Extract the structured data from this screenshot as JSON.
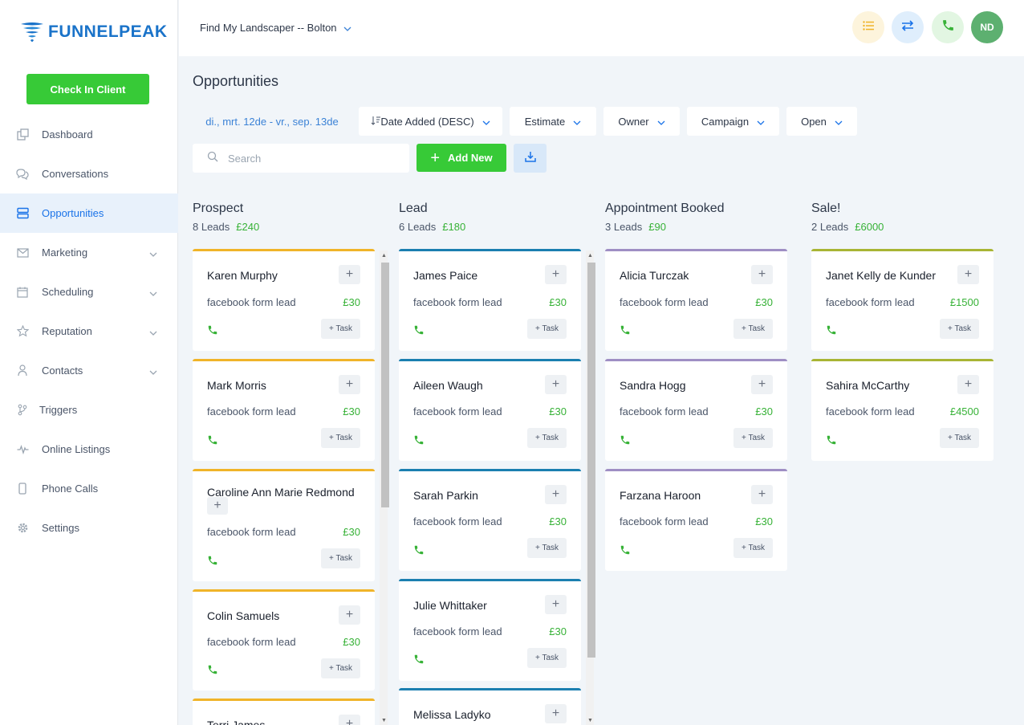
{
  "brand": {
    "logo_text_a": "FUNNELPE",
    "logo_text_b": "A",
    "logo_text_c": "K"
  },
  "sidebar": {
    "checkin_label": "Check In Client",
    "items": [
      {
        "label": "Dashboard",
        "icon": "dashboard-icon"
      },
      {
        "label": "Conversations",
        "icon": "chat-icon"
      },
      {
        "label": "Opportunities",
        "icon": "stack-icon"
      },
      {
        "label": "Marketing",
        "icon": "mail-icon"
      },
      {
        "label": "Scheduling",
        "icon": "calendar-icon"
      },
      {
        "label": "Reputation",
        "icon": "star-icon"
      },
      {
        "label": "Contacts",
        "icon": "person-icon"
      },
      {
        "label": "Triggers",
        "icon": "branch-icon"
      },
      {
        "label": "Online Listings",
        "icon": "pulse-icon"
      },
      {
        "label": "Phone Calls",
        "icon": "phone-device-icon"
      },
      {
        "label": "Settings",
        "icon": "gear-icon"
      }
    ]
  },
  "header": {
    "location": "Find My Landscaper -- Bolton",
    "avatar_initials": "ND"
  },
  "page": {
    "title": "Opportunities",
    "date_range": "di., mrt. 12de - vr., sep. 13de",
    "filters": {
      "sort": "Date Added (DESC)",
      "estimate": "Estimate",
      "owner": "Owner",
      "campaign": "Campaign",
      "status": "Open"
    },
    "search_placeholder": "Search",
    "add_new": "Add New"
  },
  "colors": {
    "green": "#37ca37",
    "blue": "#1a73e8",
    "prospect": "#f0b429",
    "lead": "#1b7fb0",
    "appointment": "#9f8fc4",
    "sale": "#a8b534"
  },
  "columns": [
    {
      "name": "Prospect",
      "count": "8 Leads",
      "amount": "£240",
      "cards": [
        {
          "name": "Karen Murphy",
          "source": "facebook form lead",
          "value": "£30",
          "task": "+ Task"
        },
        {
          "name": "Mark Morris",
          "source": "facebook form lead",
          "value": "£30",
          "task": "+ Task"
        },
        {
          "name": "Caroline Ann Marie Redmond",
          "source": "facebook form lead",
          "value": "£30",
          "task": "+ Task"
        },
        {
          "name": "Colin Samuels",
          "source": "facebook form lead",
          "value": "£30",
          "task": "+ Task"
        },
        {
          "name": "Terri James",
          "source": "",
          "value": "",
          "task": ""
        }
      ]
    },
    {
      "name": "Lead",
      "count": "6 Leads",
      "amount": "£180",
      "cards": [
        {
          "name": "James Paice",
          "source": "facebook form lead",
          "value": "£30",
          "task": "+ Task"
        },
        {
          "name": "Aileen Waugh",
          "source": "facebook form lead",
          "value": "£30",
          "task": "+ Task"
        },
        {
          "name": "Sarah Parkin",
          "source": "facebook form lead",
          "value": "£30",
          "task": "+ Task"
        },
        {
          "name": "Julie Whittaker",
          "source": "facebook form lead",
          "value": "£30",
          "task": "+ Task"
        },
        {
          "name": "Melissa Ladyko",
          "source": "",
          "value": "",
          "task": ""
        }
      ]
    },
    {
      "name": "Appointment Booked",
      "count": "3 Leads",
      "amount": "£90",
      "cards": [
        {
          "name": "Alicia Turczak",
          "source": "facebook form lead",
          "value": "£30",
          "task": "+ Task"
        },
        {
          "name": "Sandra Hogg",
          "source": "facebook form lead",
          "value": "£30",
          "task": "+ Task"
        },
        {
          "name": "Farzana Haroon",
          "source": "facebook form lead",
          "value": "£30",
          "task": "+ Task"
        }
      ]
    },
    {
      "name": "Sale!",
      "count": "2 Leads",
      "amount": "£6000",
      "cards": [
        {
          "name": "Janet Kelly de Kunder",
          "source": "facebook form lead",
          "value": "£1500",
          "task": "+ Task"
        },
        {
          "name": "Sahira McCarthy",
          "source": "facebook form lead",
          "value": "£4500",
          "task": "+ Task"
        }
      ]
    }
  ]
}
